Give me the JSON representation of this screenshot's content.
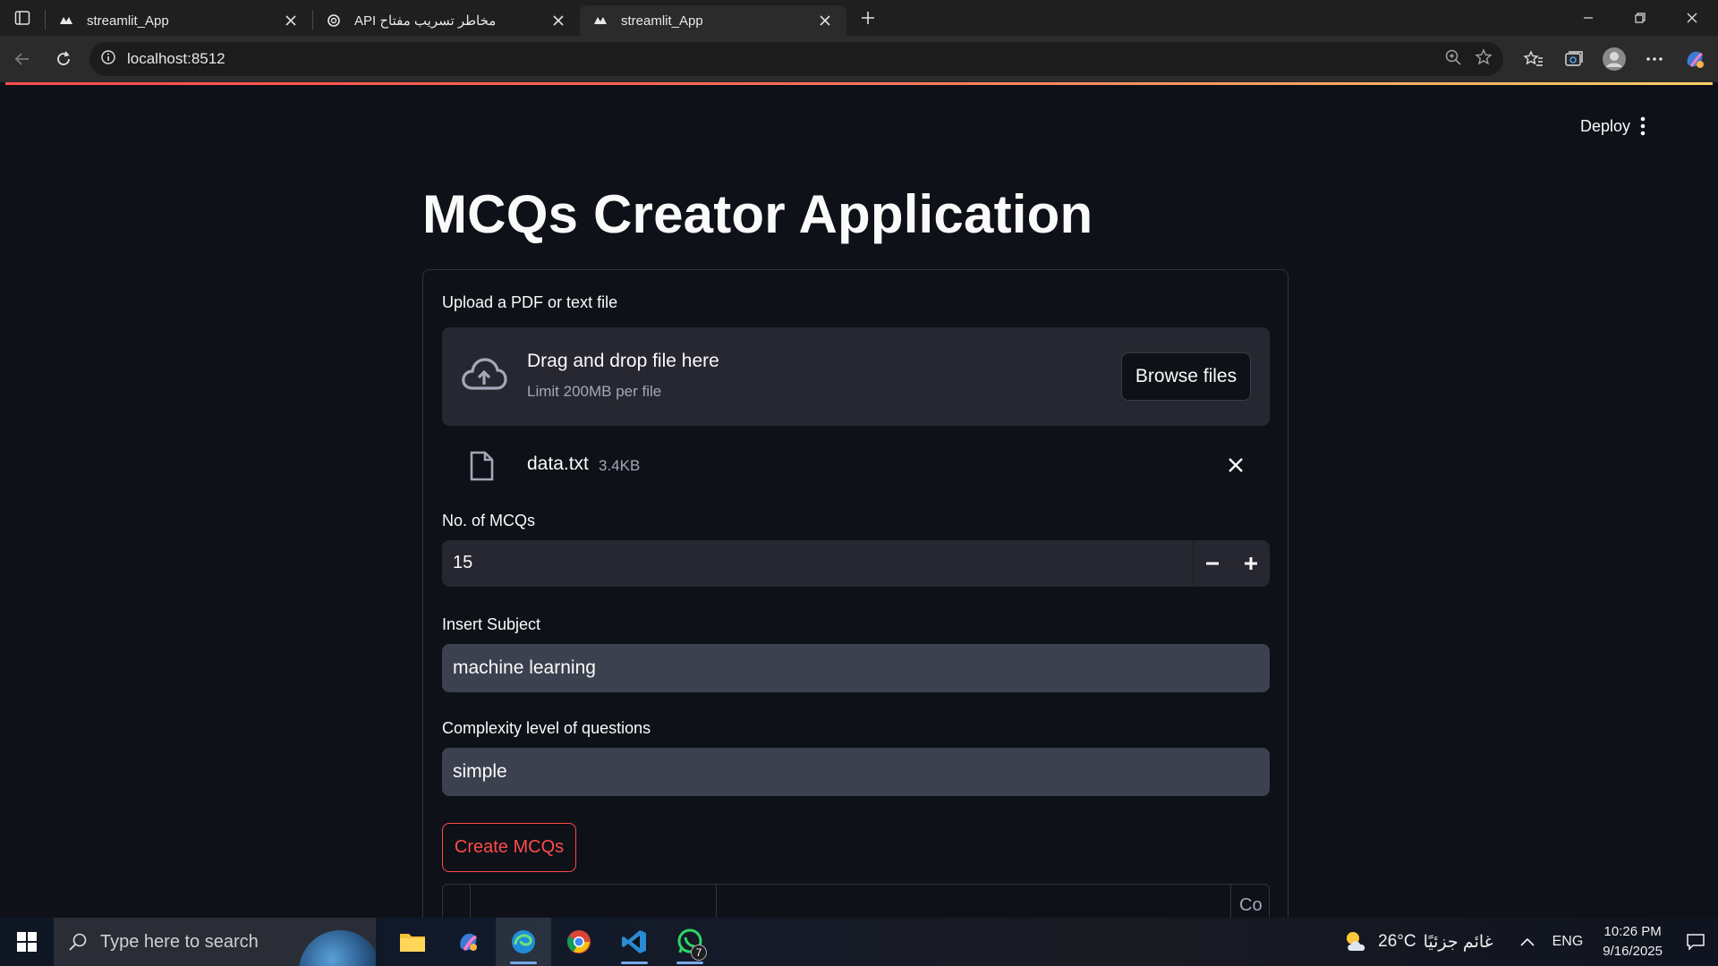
{
  "browser": {
    "tabs": [
      {
        "title": "streamlit_App",
        "active": false,
        "icon": "streamlit-logo-icon"
      },
      {
        "title": "مخاطر تسريب مفتاح API",
        "active": false,
        "icon": "chatgpt-logo-icon"
      },
      {
        "title": "streamlit_App",
        "active": true,
        "icon": "streamlit-logo-icon"
      }
    ],
    "url": "localhost:8512"
  },
  "app": {
    "deploy_label": "Deploy",
    "title": "MCQs Creator Application",
    "uploader": {
      "label": "Upload a PDF or text file",
      "drop_title": "Drag and drop file here",
      "limit": "Limit 200MB per file",
      "browse_label": "Browse files",
      "file_name": "data.txt",
      "file_size": "3.4KB"
    },
    "num_mcqs": {
      "label": "No. of MCQs",
      "value": "15"
    },
    "subject": {
      "label": "Insert Subject",
      "value": "machine learning"
    },
    "complexity": {
      "label": "Complexity level of questions",
      "value": "simple"
    },
    "create_label": "Create MCQs",
    "table_partial_header": "Co",
    "accent_color": "#ff4b4b"
  },
  "taskbar": {
    "search_placeholder": "Type here to search",
    "weather_temp": "26°C",
    "weather_desc": "غائم جزئيًا",
    "language": "ENG",
    "time": "10:26 PM",
    "date": "9/16/2025",
    "whatsapp_badge": "7"
  }
}
